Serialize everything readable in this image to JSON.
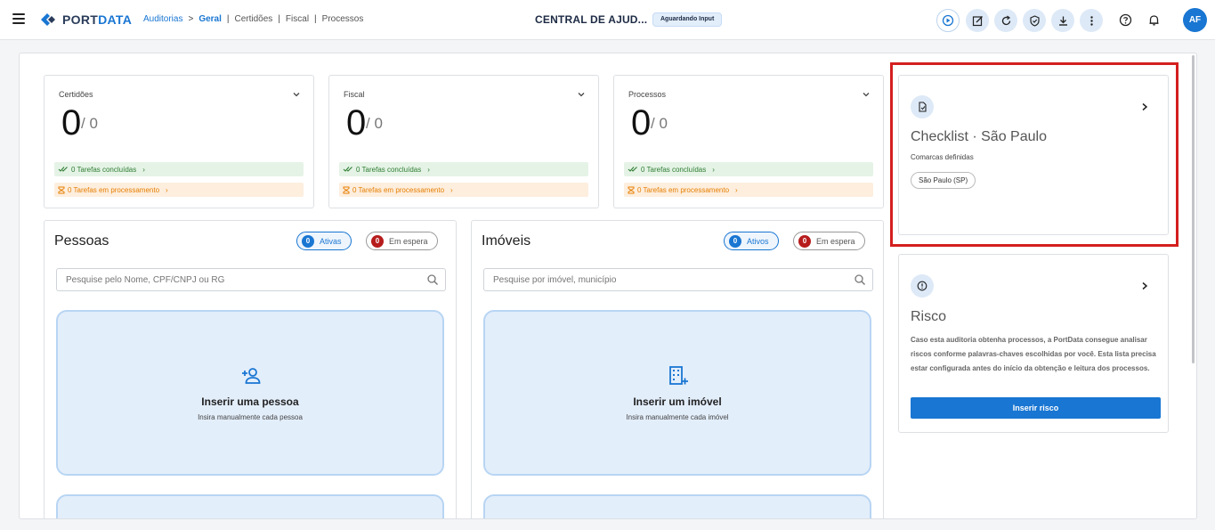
{
  "header": {
    "logo_text_a": "PORT",
    "logo_text_b": "DATA",
    "breadcrumb": {
      "root": "Auditorias",
      "arrow": ">",
      "current": "Geral",
      "sep": "|",
      "items": [
        "Certidões",
        "Fiscal",
        "Processos"
      ]
    },
    "center_title": "CENTRAL DE AJUD...",
    "status_chip": "Aguardando Input",
    "avatar_initials": "AF"
  },
  "stats": [
    {
      "label": "Certidões",
      "value": "0",
      "total": "/ 0",
      "done": "0 Tarefas concluídas",
      "processing": "0 Tarefas em processamento"
    },
    {
      "label": "Fiscal",
      "value": "0",
      "total": "/ 0",
      "done": "0 Tarefas concluídas",
      "processing": "0 Tarefas em processamento"
    },
    {
      "label": "Processos",
      "value": "0",
      "total": "/ 0",
      "done": "0 Tarefas concluídas",
      "processing": "0 Tarefas em processamento"
    }
  ],
  "pessoas": {
    "title": "Pessoas",
    "active_count": "0",
    "active_label": "Ativas",
    "waiting_count": "0",
    "waiting_label": "Em espera",
    "search_placeholder": "Pesquise pelo Nome, CPF/CNPJ ou RG",
    "insert_title": "Inserir uma pessoa",
    "insert_subtitle": "Insira manualmente cada pessoa"
  },
  "imoveis": {
    "title": "Imóveis",
    "active_count": "0",
    "active_label": "Ativos",
    "waiting_count": "0",
    "waiting_label": "Em espera",
    "search_placeholder": "Pesquise por imóvel, município",
    "insert_title": "Inserir um imóvel",
    "insert_subtitle": "Insira manualmente cada imóvel"
  },
  "checklist": {
    "title": "Checklist · São Paulo",
    "subtitle": "Comarcas definidas",
    "chip": "São Paulo (SP)"
  },
  "risco": {
    "title": "Risco",
    "description": "Caso esta auditoria obtenha processos, a PortData consegue analisar riscos conforme palavras-chaves escolhidas por você. Esta lista precisa estar configurada antes do início da obtenção e leitura dos processos.",
    "button": "Inserir risco"
  },
  "colors": {
    "accent": "#1976d2",
    "highlight": "#d41f1f",
    "success": "#2e7d32",
    "warning": "#e67e00",
    "waiting_badge": "#b71c1c"
  },
  "icons": [
    "menu-icon",
    "play-icon",
    "edit-icon",
    "refresh-icon",
    "shield-icon",
    "download-icon",
    "more-vert-icon",
    "help-icon",
    "bell-icon",
    "chevron-down-icon",
    "check-icon",
    "hourglass-icon",
    "search-icon",
    "person-add-icon",
    "building-add-icon",
    "document-icon",
    "alert-icon",
    "chevron-right-icon"
  ]
}
